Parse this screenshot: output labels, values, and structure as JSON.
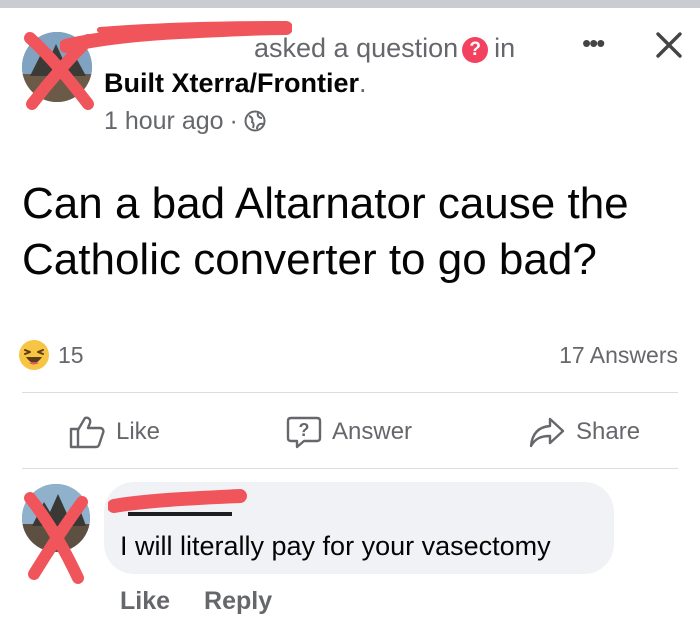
{
  "post": {
    "asked_text": "asked a question",
    "question_badge": "?",
    "in_text": "in",
    "group_name": "Built Xterra/Frontier",
    "group_suffix": ".",
    "time": "1 hour ago",
    "separator": "·",
    "more_label": "•••",
    "question": "Can a bad Altarnator cause the Catholic converter to go bad?",
    "reaction_count": "15",
    "answers_count": "17 Answers"
  },
  "actions": {
    "like": "Like",
    "answer": "Answer",
    "share": "Share"
  },
  "comment": {
    "text": "I will literally pay for your vasectomy",
    "like": "Like",
    "reply": "Reply"
  },
  "icons": {
    "reaction": "haha-emoji-icon",
    "privacy": "globe-icon",
    "like": "thumbs-up-icon",
    "answer": "question-bubble-icon",
    "share": "share-arrow-icon",
    "close": "close-icon",
    "more": "more-dots-icon"
  },
  "colors": {
    "text": "#050505",
    "secondary": "#65676b",
    "badge": "#f3425f",
    "redaction": "#f0555c",
    "bubble": "#f0f2f5"
  }
}
